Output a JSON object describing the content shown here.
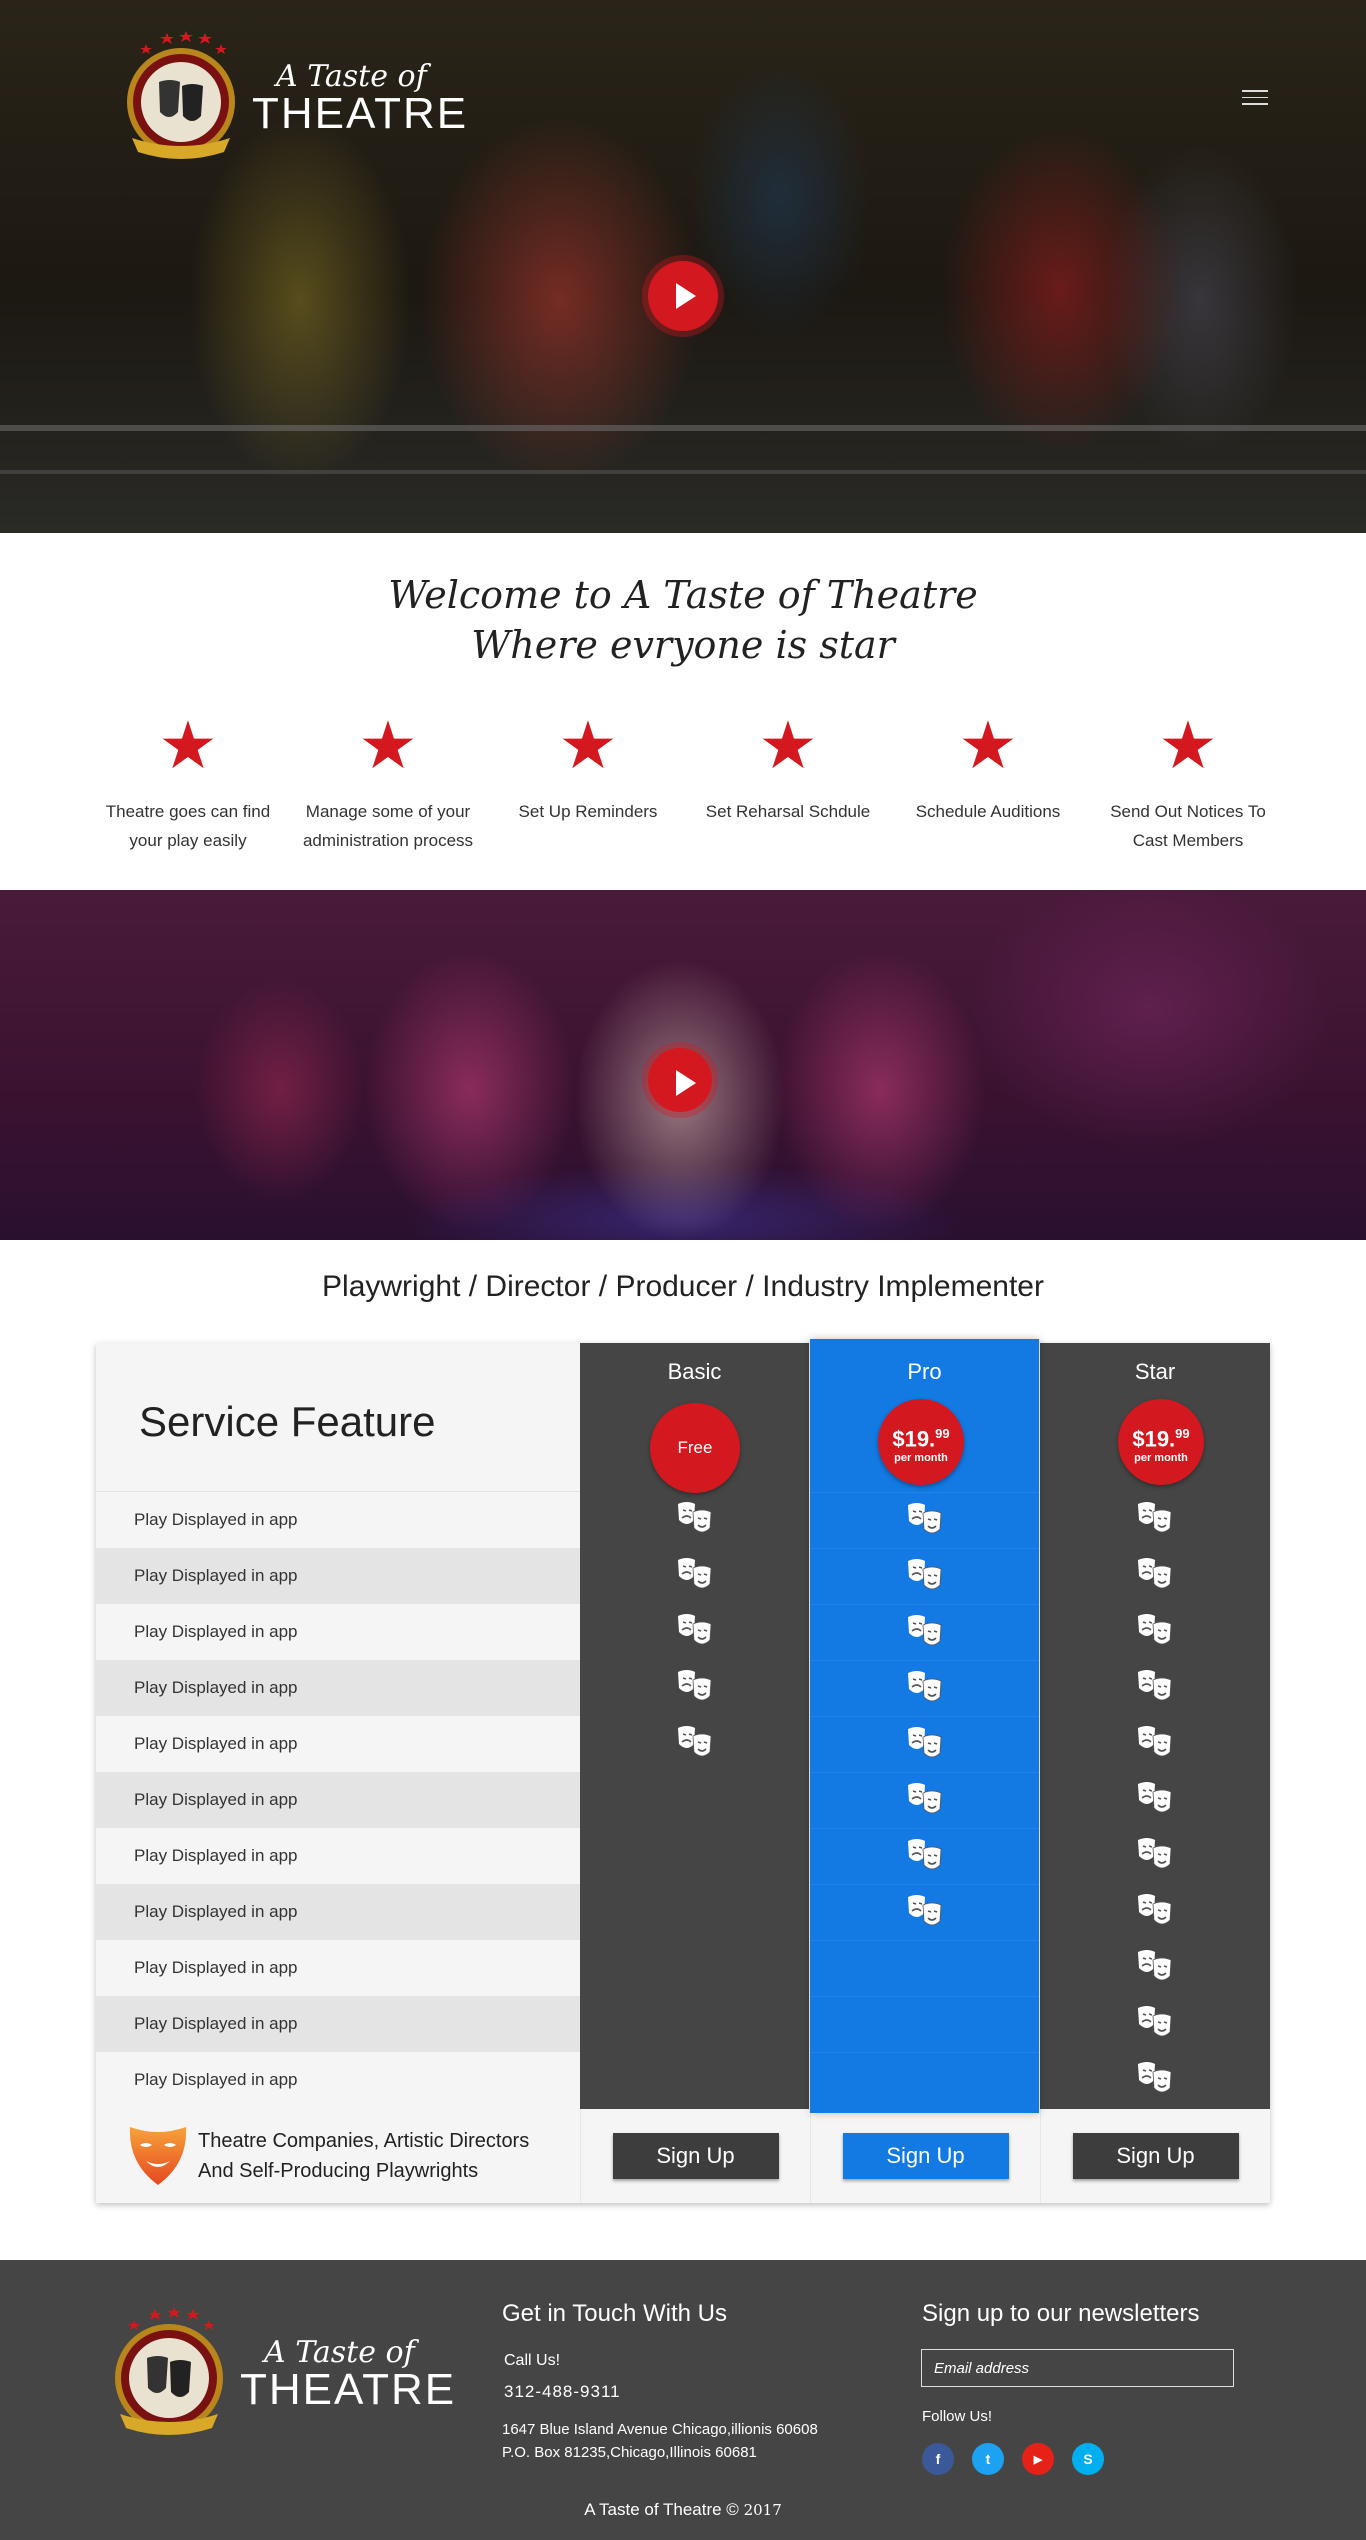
{
  "brand": {
    "line1": "A Taste of",
    "line2": "THEATRE"
  },
  "hero": {
    "menu_icon": "hamburger-icon",
    "play_icon": "play-icon"
  },
  "welcome": {
    "title_line1": "Welcome to A Taste of Theatre",
    "title_line2": "Where evryone is star",
    "features": [
      {
        "icon": "star-icon",
        "text": "Theatre goes can find your play easily"
      },
      {
        "icon": "star-icon",
        "text": "Manage some of your administration process"
      },
      {
        "icon": "star-icon",
        "text": "Set Up Reminders"
      },
      {
        "icon": "star-icon",
        "text": "Set Reharsal Schdule"
      },
      {
        "icon": "star-icon",
        "text": "Schedule Auditions"
      },
      {
        "icon": "star-icon",
        "text": "Send Out Notices To Cast Members"
      }
    ]
  },
  "pricing": {
    "title": "Playwright / Director / Producer / Industry Implementer",
    "feature_header": "Service Feature",
    "rows": [
      "Play Displayed in app",
      "Play Displayed in app",
      "Play Displayed in app",
      "Play Displayed in app",
      "Play Displayed in app",
      "Play Displayed in app",
      "Play Displayed in app",
      "Play Displayed in app",
      "Play Displayed in app",
      "Play Displayed in app",
      "Play Displayed in app"
    ],
    "footer_text_line1": "Theatre Companies, Artistic Directors",
    "footer_text_line2": "And Self-Producing Playwrights",
    "plans": [
      {
        "name": "Basic",
        "price_label": "Free",
        "included_rows": 5,
        "signup_label": "Sign Up",
        "color": "#454545"
      },
      {
        "name": "Pro",
        "price_main": "$19.",
        "price_cents": "99",
        "price_period": "per month",
        "included_rows": 8,
        "signup_label": "Sign Up",
        "color": "#1379e3"
      },
      {
        "name": "Star",
        "price_main": "$19.",
        "price_cents": "99",
        "price_period": "per month",
        "included_rows": 11,
        "signup_label": "Sign Up",
        "color": "#454545"
      }
    ],
    "accent_color": "#d4181f"
  },
  "footer": {
    "contact_heading": "Get in Touch With Us",
    "call_label": "Call Us!",
    "phone": "312-488-9311",
    "address1": "1647 Blue Island Avenue Chicago,illionis 60608",
    "address2": "P.O. Box 81235,Chicago,Illinois 60681",
    "newsletter_heading": "Sign up to our newsletters",
    "email_placeholder": "Email address",
    "follow_label": "Follow Us!",
    "socials": [
      {
        "name": "facebook-icon",
        "glyph": "f",
        "color": "#3b5998"
      },
      {
        "name": "twitter-icon",
        "glyph": "t",
        "color": "#1da1f2"
      },
      {
        "name": "youtube-icon",
        "glyph": "▶",
        "color": "#e62117"
      },
      {
        "name": "skype-icon",
        "glyph": "S",
        "color": "#00aff0"
      }
    ],
    "copyright": "A Taste of Theatre ©",
    "copyright_year": "2017"
  }
}
